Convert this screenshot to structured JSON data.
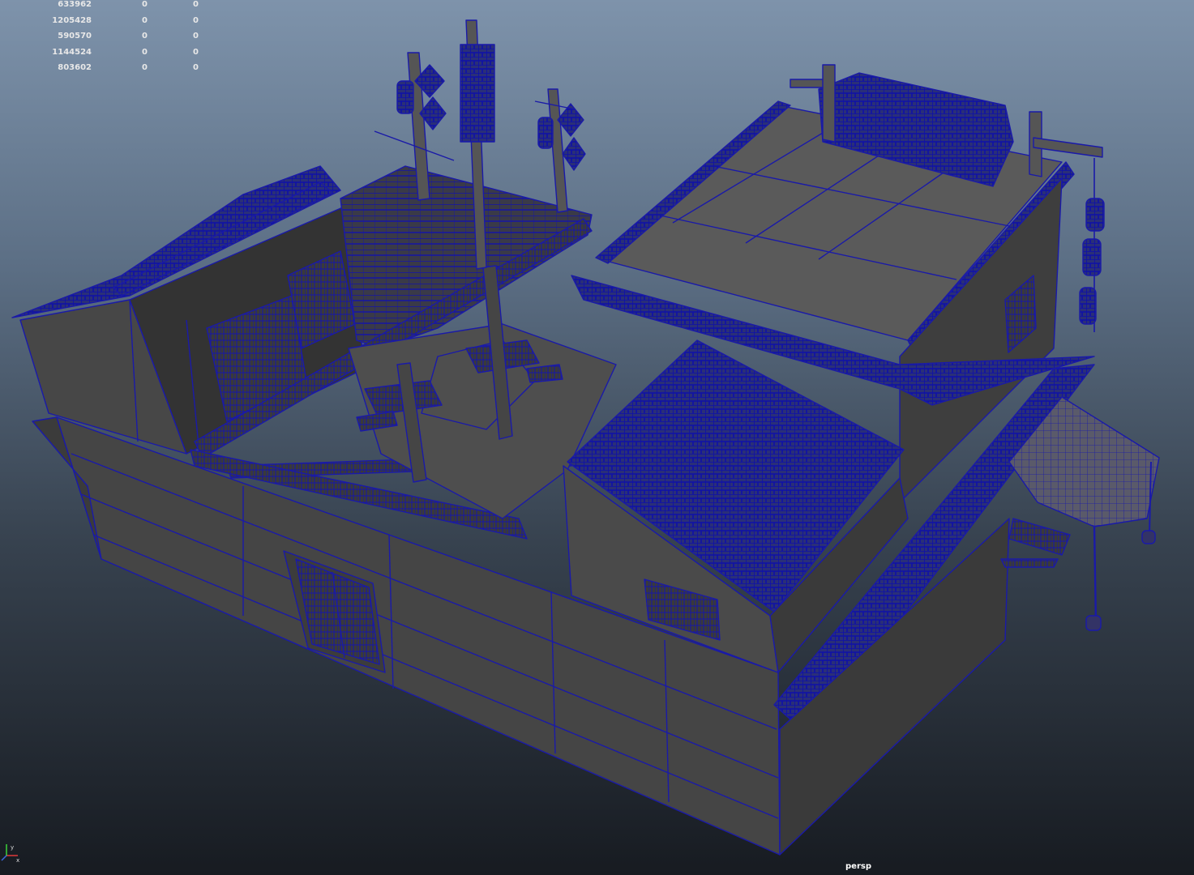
{
  "hud": {
    "rows": [
      {
        "a": "633962",
        "b": "0",
        "c": "0"
      },
      {
        "a": "1205428",
        "b": "0",
        "c": "0"
      },
      {
        "a": "590570",
        "b": "0",
        "c": "0"
      },
      {
        "a": "1144524",
        "b": "0",
        "c": "0"
      },
      {
        "a": "803602",
        "b": "0",
        "c": "0"
      }
    ]
  },
  "viewport": {
    "camera": "persp",
    "wireframe_color": "#1a1aa8",
    "surface_color": "#4a4a4a"
  },
  "axis_gizmo": {
    "icon": "axis-gizmo-icon",
    "x_color": "#e03a3a",
    "y_color": "#3ad43a",
    "z_color": "#3a6ae0"
  }
}
